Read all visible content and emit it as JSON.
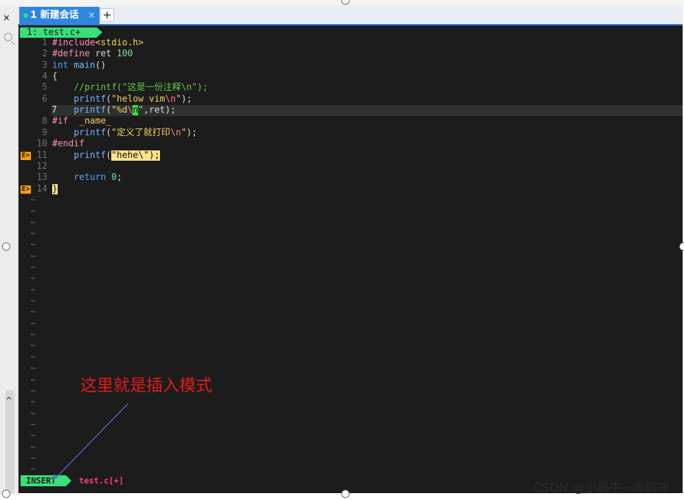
{
  "window": {
    "close_glyph": "×",
    "tab": {
      "label": "1 新建会话",
      "close": "×",
      "add": "+"
    }
  },
  "editor": {
    "bufferline": "1: test.c+",
    "lines": [
      {
        "num": "1",
        "cls": "",
        "sign": "",
        "html": "<span class=\"c-inc\">#include</span><span class=\"c-str\">&lt;stdio.h&gt;</span>"
      },
      {
        "num": "2",
        "cls": "",
        "sign": "",
        "html": "<span class=\"c-inc\">#define</span> ret <span class=\"c-num\">100</span>"
      },
      {
        "num": "3",
        "cls": "",
        "sign": "",
        "html": "<span class=\"c-kw\">int</span> <span class=\"c-fn\">main</span>()"
      },
      {
        "num": "4",
        "cls": "",
        "sign": "",
        "html": "{"
      },
      {
        "num": "5",
        "cls": "",
        "sign": "",
        "html": "    <span class=\"c-cmt\">//printf(\"这是一份注释\\n\");</span>"
      },
      {
        "num": "6",
        "cls": "",
        "sign": "",
        "html": "    <span class=\"c-fn\">printf</span>(<span class=\"c-str\">\"helow vim</span><span class=\"c-esc\">\\n</span><span class=\"c-str\">\"</span>);"
      },
      {
        "num": "7",
        "cls": "cur",
        "sign": "",
        "html": "    <span class=\"c-fn\">printf</span>(<span class=\"c-str\">\"%d</span><span class=\"c-esc\">\\<span class=\"c-cursor\">n</span></span><span class=\"c-str\">\"</span>,ret);"
      },
      {
        "num": "8",
        "cls": "",
        "sign": "",
        "html": "<span class=\"c-inc\">#if</span>  <span class=\"c-str\">_name_</span>"
      },
      {
        "num": "9",
        "cls": "",
        "sign": "",
        "html": "    <span class=\"c-fn\">printf</span>(<span class=\"c-str\">\"定义了就打印</span><span class=\"c-esc\">\\n</span><span class=\"c-str\">\"</span>);"
      },
      {
        "num": "10",
        "cls": "",
        "sign": "",
        "html": "<span class=\"c-inc\">#endif</span>"
      },
      {
        "num": "11",
        "cls": "",
        "sign": "E>",
        "html": "    <span class=\"c-fn\">printf</span>(<span class=\"c-err\">\"hehe\\\");</span>"
      },
      {
        "num": "12",
        "cls": "",
        "sign": "",
        "html": ""
      },
      {
        "num": "13",
        "cls": "",
        "sign": "",
        "html": "    <span class=\"c-kw\">return</span> <span class=\"c-num\">0</span>;"
      },
      {
        "num": "14",
        "cls": "",
        "sign": "E>",
        "html": "<span class=\"c-err\">}</span>"
      }
    ],
    "tilde": "~",
    "tilde_count": 25,
    "status_mode": "INSERT",
    "status_file": "test.c[+]"
  },
  "annotation": "这里就是插入模式",
  "watermark": "CSDN @小蜗牛~向前冲"
}
